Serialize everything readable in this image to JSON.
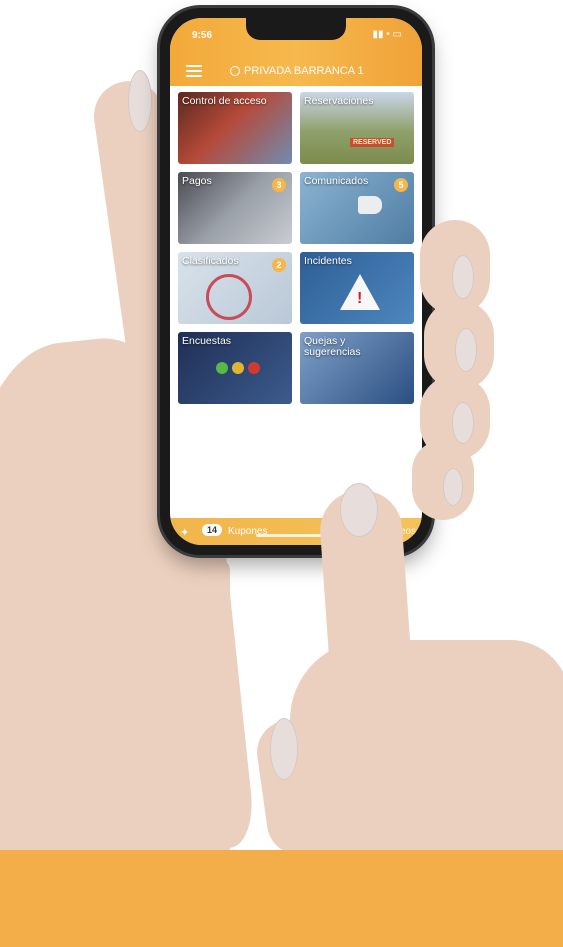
{
  "status_bar": {
    "time": "9:56",
    "icons": "▮▮ • ▭"
  },
  "header": {
    "title": "PRIVADA BARRANCA 1"
  },
  "tiles": [
    {
      "label": "Control de acceso",
      "badge": ""
    },
    {
      "label": "Reservaciones",
      "badge": "",
      "sign": "RESERVED"
    },
    {
      "label": "Pagos",
      "badge": "3"
    },
    {
      "label": "Comunicados",
      "badge": "5"
    },
    {
      "label": "Clasificados",
      "badge": "2"
    },
    {
      "label": "Incidentes",
      "badge": ""
    },
    {
      "label": "Encuestas",
      "badge": ""
    },
    {
      "label": "Quejas y sugerencias",
      "badge": ""
    }
  ],
  "bottom_bar": {
    "coupon_count": "14",
    "coupon_label": "Kupones",
    "right_label": "Teos"
  },
  "colors": {
    "brand": "#f3ae49",
    "header": "#f3a93a",
    "badge": "#f5b74a"
  },
  "icons": [
    "menu-icon",
    "location-pin-icon",
    "coupon-icon",
    "warning-icon",
    "megaphone-icon"
  ]
}
